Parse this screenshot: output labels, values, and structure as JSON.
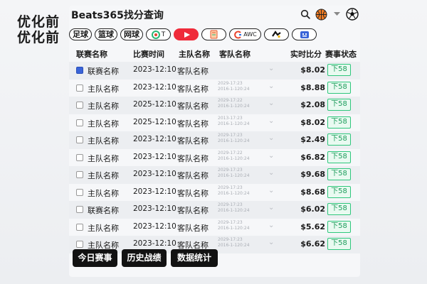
{
  "side_labels": [
    "优化前",
    "优化前"
  ],
  "app": {
    "title": "Beats365找分查询"
  },
  "header_icons": [
    "search-icon",
    "basketball-icon",
    "dropdown-caret-icon",
    "soccer-ball-icon"
  ],
  "tabs": [
    {
      "label": "足球",
      "kind": "text"
    },
    {
      "label": "篮球",
      "kind": "text"
    },
    {
      "label": "网球",
      "kind": "text"
    },
    {
      "label": "T",
      "kind": "icon",
      "icon": "gem-icon"
    },
    {
      "label": "",
      "kind": "icon",
      "icon": "play-icon",
      "active": true
    },
    {
      "label": "",
      "kind": "icon",
      "icon": "document-icon"
    },
    {
      "label": "AWC",
      "kind": "wide",
      "icon": "swirl-icon"
    },
    {
      "label": "",
      "kind": "icon",
      "icon": "shape-icon"
    },
    {
      "label": "",
      "kind": "icon",
      "icon": "shield-grid-icon"
    }
  ],
  "columns": {
    "league": "联赛名称",
    "time": "比赛时间",
    "home": "主队名称",
    "away": "客队名称",
    "score": "实时比分",
    "status": "赛事状态"
  },
  "rows": [
    {
      "checked": true,
      "league": "联赛名称",
      "time": "2023-12:10",
      "home": "客队名称",
      "away_line1": "",
      "away_line2": "",
      "score": "$8.02",
      "status": "下58"
    },
    {
      "checked": false,
      "league": "主队名称",
      "time": "2023-12:10",
      "home": "客队名称",
      "away_line1": "2029-17:23",
      "away_line2": "2016-1-120:24",
      "score": "$8.88",
      "status": "下58"
    },
    {
      "checked": false,
      "league": "主队名称",
      "time": "2025-12:10",
      "home": "客队名称",
      "away_line1": "2029-17:22",
      "away_line2": "2016-1-120:24",
      "score": "$2.08",
      "status": "下58"
    },
    {
      "checked": false,
      "league": "主队名称",
      "time": "2025-12:10",
      "home": "客队名称",
      "away_line1": "2013-17:23",
      "away_line2": "2016-1-120:24",
      "score": "$8.02",
      "status": "下58"
    },
    {
      "checked": false,
      "league": "主队名称",
      "time": "2023-12:10",
      "home": "客队名称",
      "away_line1": "2029-17:23",
      "away_line2": "2016-1-120:24",
      "score": "$2.49",
      "status": "下58"
    },
    {
      "checked": false,
      "league": "主队名称",
      "time": "2023-12:10",
      "home": "客队名称",
      "away_line1": "2029-17:22",
      "away_line2": "2016-1-120:24",
      "score": "$6.82",
      "status": "下58"
    },
    {
      "checked": false,
      "league": "主队名称",
      "time": "2023-12:10",
      "home": "客队名称",
      "away_line1": "2029-17:23",
      "away_line2": "2016-1-120:24",
      "score": "$9.68",
      "status": "下58"
    },
    {
      "checked": false,
      "league": "主队名称",
      "time": "2023-12:10",
      "home": "客队名称",
      "away_line1": "2029-17:23",
      "away_line2": "2016-1-120:24",
      "score": "$8.68",
      "status": "下58"
    },
    {
      "checked": false,
      "league": "联赛名称",
      "time": "2023-12:10",
      "home": "客队名称",
      "away_line1": "2029-17:23",
      "away_line2": "2016-1-120:24",
      "score": "$6.02",
      "status": "下58"
    },
    {
      "checked": false,
      "league": "主队名称",
      "time": "2023-12:10",
      "home": "客队名称",
      "away_line1": "2029-17:23",
      "away_line2": "2016-1-120:24",
      "score": "$5.62",
      "status": "下58"
    },
    {
      "checked": false,
      "league": "主队名称",
      "time": "2023-12:10",
      "home": "客队名称",
      "away_line1": "2029-17:23",
      "away_line2": "2016-1-120:24",
      "score": "$6.62",
      "status": "下58"
    }
  ],
  "footer": {
    "today": "今日赛事",
    "history": "历史战绩",
    "stats": "数据统计"
  },
  "colors": {
    "active_tab": "#ef2b3a",
    "status_border": "#2fc77c",
    "checkbox_checked": "#3a64d8",
    "footer_button": "#121212"
  }
}
